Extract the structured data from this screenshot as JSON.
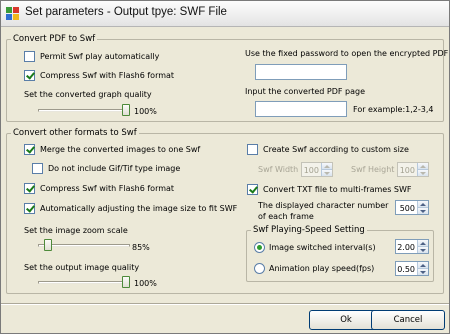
{
  "window": {
    "title": "Set parameters - Output tpye: SWF File"
  },
  "pdf_group": {
    "legend": "Convert PDF to Swf",
    "permit_autoplay": "Permit Swf play automatically",
    "compress": "Compress Swf with Flash6 format",
    "quality_label": "Set the converted graph quality",
    "quality_value": "100%",
    "quality_level": 1.0,
    "password_label": "Use the fixed password to open the encrypted PDF",
    "password_value": "",
    "page_label": "Input the converted PDF page",
    "page_value": "",
    "page_example": "For example:1,2-3,4"
  },
  "other_group": {
    "legend": "Convert other formats to Swf",
    "merge": "Merge the converted images to one Swf",
    "no_gif": "Do not include Gif/Tif type image",
    "compress": "Compress Swf with Flash6 format",
    "auto_adjust": "Automatically adjusting the image size to fit SWF",
    "zoom_label": "Set the image zoom scale",
    "zoom_value": "85%",
    "zoom_level": 0.85,
    "img_quality_label": "Set the output image quality",
    "img_quality_value": "100%",
    "img_quality_level": 1.0,
    "custom_size": "Create Swf according to custom size",
    "width_label": "Swf Width",
    "width_value": "100",
    "height_label": "Swf Height",
    "height_value": "100",
    "convert_txt": "Convert TXT file to multi-frames SWF",
    "chars_label": "The displayed character number of each frame",
    "chars_value": "500"
  },
  "speed_group": {
    "legend": "Swf Playing-Speed Setting",
    "interval_label": "Image switched interval(s)",
    "interval_value": "2.00",
    "fps_label": "Animation play speed(fps)",
    "fps_value": "0.50"
  },
  "buttons": {
    "ok": "Ok",
    "cancel": "Cancel"
  },
  "colors": {
    "accent": "#2e9a2e",
    "window_bg": "#ece9d8",
    "border": "#7f9db9"
  }
}
